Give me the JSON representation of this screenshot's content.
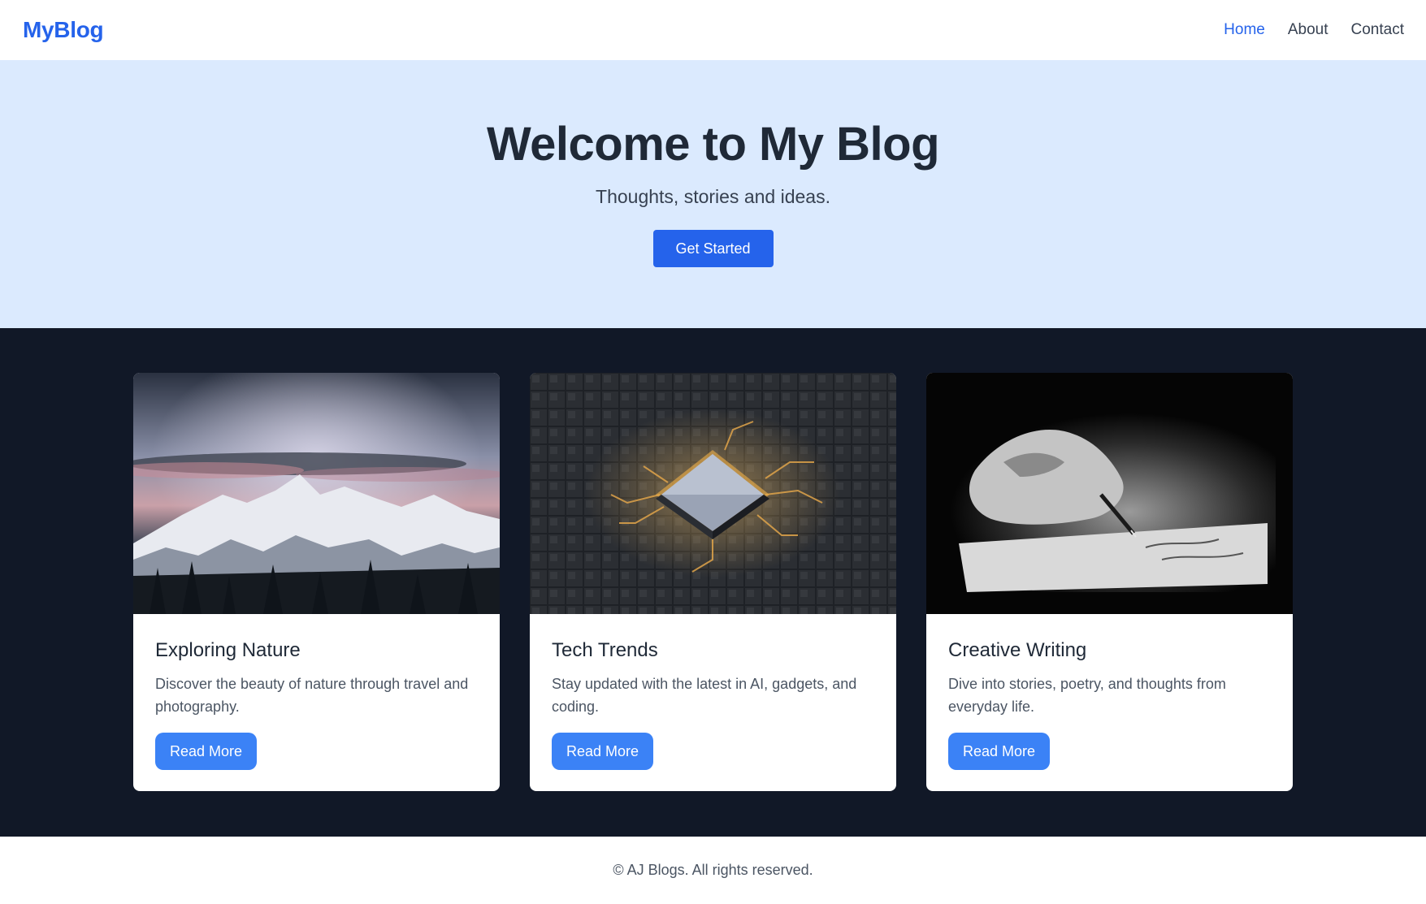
{
  "brand": {
    "name": "MyBlog"
  },
  "nav": {
    "items": [
      {
        "label": "Home",
        "active": true
      },
      {
        "label": "About",
        "active": false
      },
      {
        "label": "Contact",
        "active": false
      }
    ]
  },
  "hero": {
    "title": "Welcome to My Blog",
    "subtitle": "Thoughts, stories and ideas.",
    "button_label": "Get Started"
  },
  "posts": [
    {
      "title": "Exploring Nature",
      "description": "Discover the beauty of nature through travel and photography.",
      "button_label": "Read More",
      "image": "snowy-mountain-photo"
    },
    {
      "title": "Tech Trends",
      "description": "Stay updated with the latest in AI, gadgets, and coding.",
      "button_label": "Read More",
      "image": "glowing-microchip-photo"
    },
    {
      "title": "Creative Writing",
      "description": "Dive into stories, poetry, and thoughts from everyday life.",
      "button_label": "Read More",
      "image": "hand-writing-with-pen-photo"
    }
  ],
  "footer": {
    "text": "© AJ Blogs. All rights reserved."
  },
  "colors": {
    "accent": "#2563eb",
    "hero_bg": "#dbeafe",
    "posts_bg": "#111827",
    "card_button": "#3b82f6"
  }
}
